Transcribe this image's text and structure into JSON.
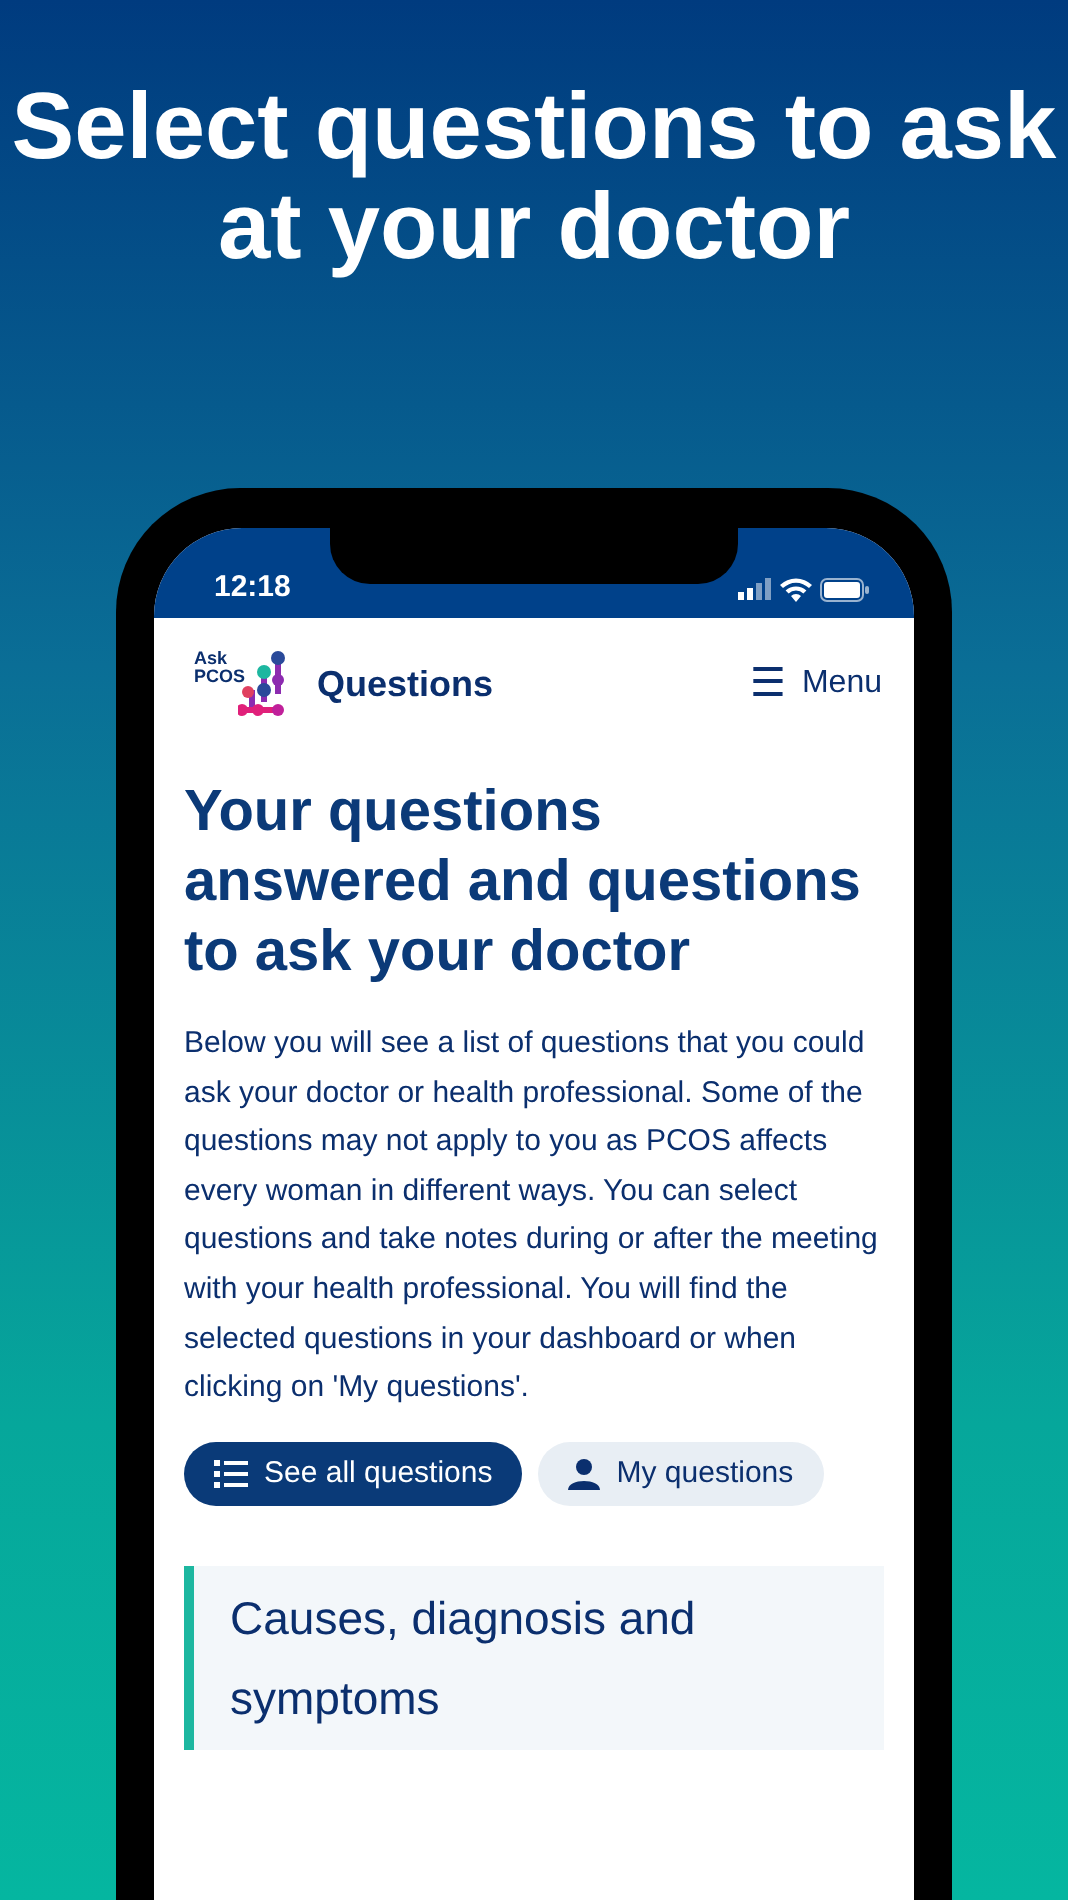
{
  "headline": "Select questions to ask at your doctor",
  "status_bar": {
    "time": "12:18"
  },
  "header": {
    "logo_lines": [
      "Ask",
      "PCOS"
    ],
    "title": "Questions",
    "menu_icon": "☰",
    "menu_label": "Menu"
  },
  "page": {
    "title": "Your questions answered and questions to ask your doctor",
    "intro": "Below you will see a list of questions that you could ask your doctor or health professional. Some of the questions may not apply to you as PCOS affects every woman in different ways. You can select questions and take notes during or after the meeting with your health professional. You will find the selected questions in your dashboard or when clicking on 'My questions'.",
    "buttons": [
      {
        "label": "See all questions",
        "kind": "list",
        "selected": true
      },
      {
        "label": "My questions",
        "kind": "person",
        "selected": false
      }
    ],
    "sections": [
      {
        "title": "Causes, diagnosis and symptoms",
        "color": "#1db7a0"
      }
    ]
  }
}
